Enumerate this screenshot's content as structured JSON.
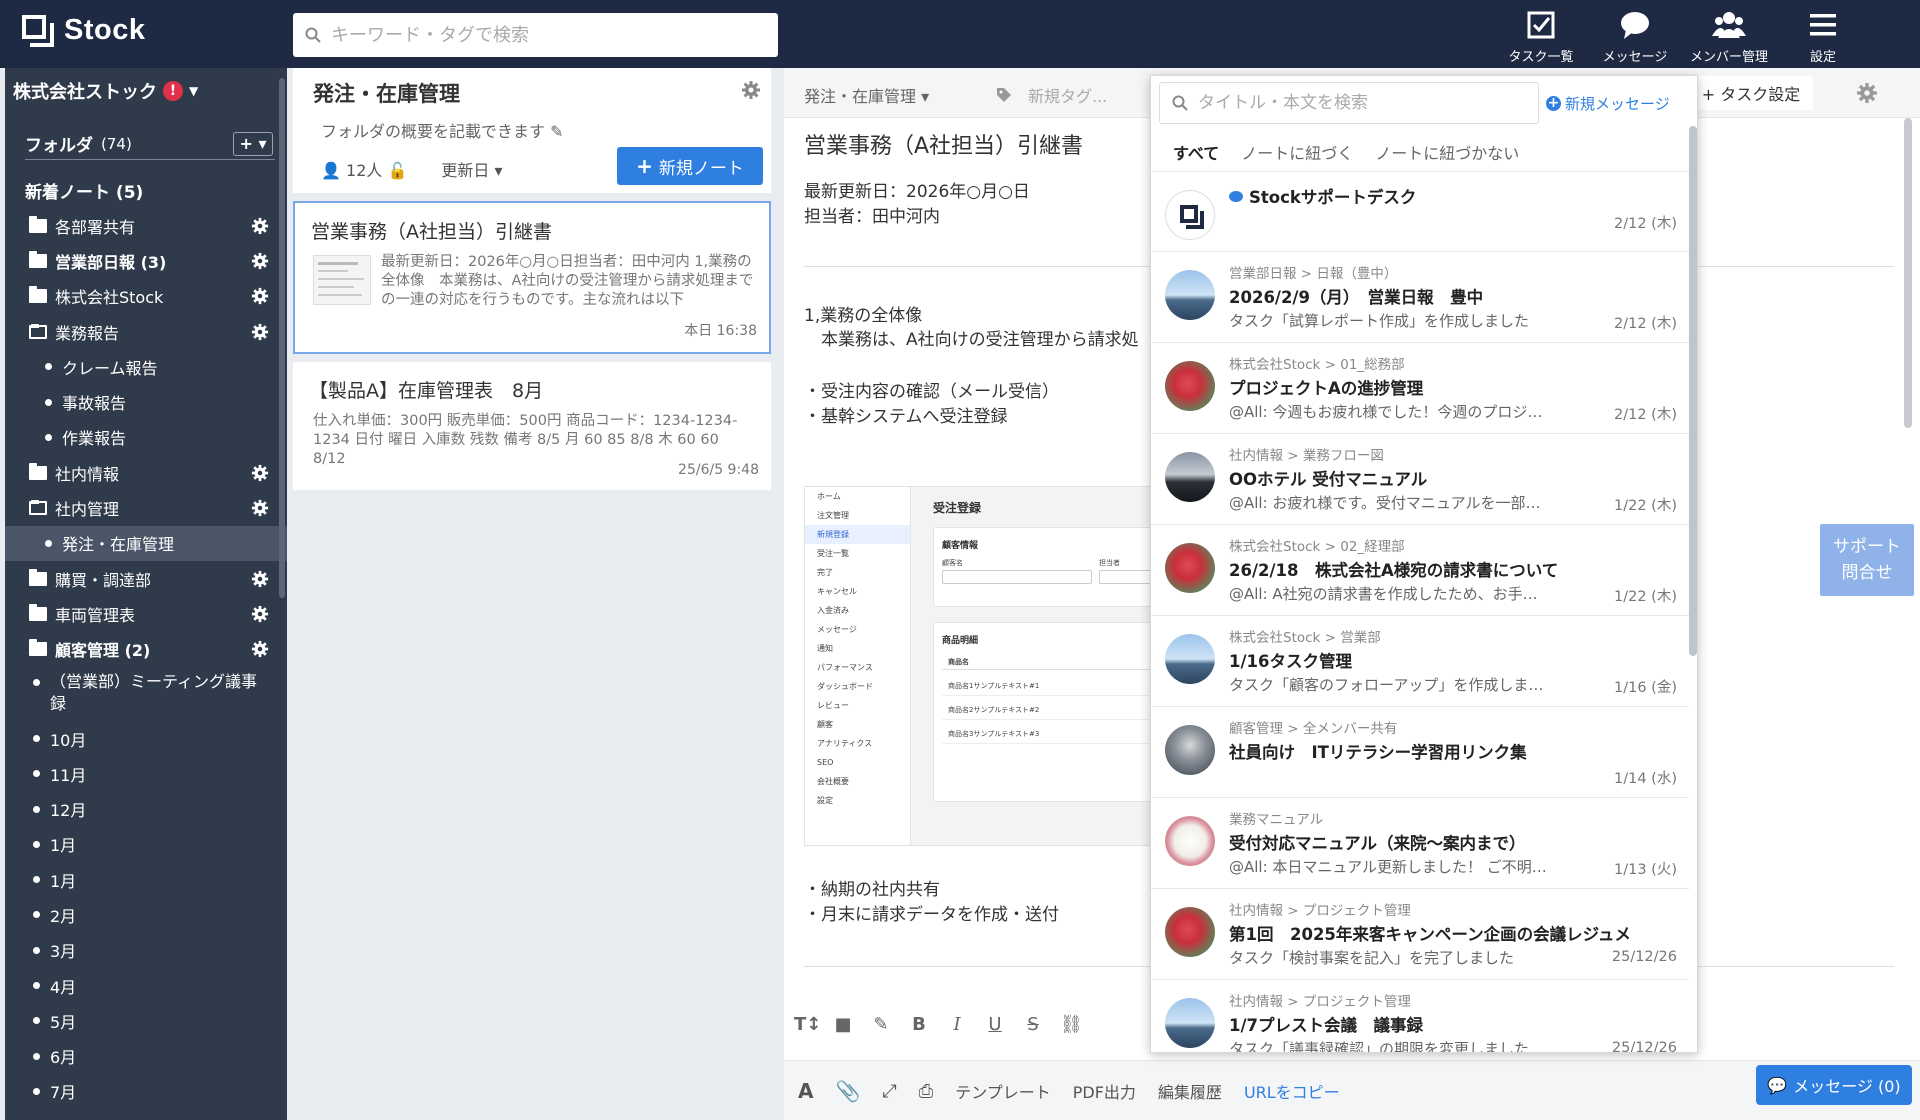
{
  "app": {
    "logo": "Stock",
    "search_placeholder": "キーワード・タグで検索",
    "nav": [
      {
        "label": "タスク一覧",
        "icon": "task-list-icon"
      },
      {
        "label": "メッセージ",
        "icon": "message-icon"
      },
      {
        "label": "メンバー管理",
        "icon": "members-icon"
      },
      {
        "label": "設定",
        "icon": "menu-icon"
      }
    ]
  },
  "sidebar": {
    "company": "株式会社ストック",
    "folder_label": "フォルダ",
    "folder_count": "(74)",
    "add_label": "+ ▾",
    "new_notes": "新着ノート (5)",
    "items": [
      {
        "label": "各部署共有",
        "type": "folder"
      },
      {
        "label": "営業部日報 (3)",
        "type": "folder",
        "bold": true
      },
      {
        "label": "株式会社Stock",
        "type": "folder"
      },
      {
        "label": "業務報告",
        "type": "folder-open"
      },
      {
        "label": "クレーム報告",
        "type": "sub"
      },
      {
        "label": "事故報告",
        "type": "sub"
      },
      {
        "label": "作業報告",
        "type": "sub"
      },
      {
        "label": "社内情報",
        "type": "folder"
      },
      {
        "label": "社内管理",
        "type": "folder-open"
      },
      {
        "label": "発注・在庫管理",
        "type": "sub",
        "selected": true
      },
      {
        "label": "購買・調達部",
        "type": "folder"
      },
      {
        "label": "車両管理表",
        "type": "folder"
      },
      {
        "label": "顧客管理 (2)",
        "type": "folder",
        "bold": true
      },
      {
        "label": "（営業部）ミーティング議事録",
        "type": "root-tall"
      },
      {
        "label": "10月",
        "type": "root"
      },
      {
        "label": "11月",
        "type": "root"
      },
      {
        "label": "12月",
        "type": "root"
      },
      {
        "label": "1月",
        "type": "root"
      },
      {
        "label": "1月",
        "type": "root"
      },
      {
        "label": "2月",
        "type": "root"
      },
      {
        "label": "3月",
        "type": "root"
      },
      {
        "label": "4月",
        "type": "root"
      },
      {
        "label": "5月",
        "type": "root"
      },
      {
        "label": "6月",
        "type": "root"
      },
      {
        "label": "7月",
        "type": "root"
      }
    ]
  },
  "notes": {
    "folder_title": "発注・在庫管理",
    "folder_desc": "フォルダの概要を記載できます",
    "members": "12人",
    "sort": "更新日 ▾",
    "new_note": "新規ノート",
    "cards": [
      {
        "title": "営業事務（A社担当）引継書",
        "body": "最新更新日：2026年○月○日担当者：田中河内 1,業務の全体像　本業務は、A社向けの受注管理から請求処理までの一連の対応を行うものです。主な流れは以下",
        "date": "本日 16:38"
      },
      {
        "title": "【製品A】在庫管理表　8月",
        "body": "仕入れ単価：300円 販売単価：500円 商品コード：1234-1234-1234 日付 曜日 入庫数 残数 備考 8/5 月 60 85 8/8 木 60 60 8/12",
        "date": "25/6/5 9:48"
      }
    ]
  },
  "editor": {
    "breadcrumb": "発注・在庫管理 ▾",
    "tag_new": "新規タグ...",
    "task_settings": "+ タスク設定",
    "title": "営業事務（A社担当）引継書",
    "meta1": "最新更新日：2026年○月○日",
    "meta2": "担当者：田中河内",
    "h1": "1,業務の全体像",
    "p1": "　本業務は、A社向けの受注管理から請求処",
    "b1": "・受注内容の確認（メール受信）",
    "b2": "・基幹システムへ受注登録",
    "b3": "・納期の社内共有",
    "b4": "・月末に請求データを作成・送付",
    "img": {
      "nav": [
        "ホーム",
        "注文管理",
        "新規登録",
        "受注一覧",
        "完了",
        "キャンセル",
        "入金済み",
        "メッセージ",
        "通知",
        "パフォーマンス",
        "ダッシュボード",
        "レビュー",
        "顧客",
        "アナリティクス",
        "SEO",
        "会社概要",
        "設定"
      ],
      "title": "受注登録",
      "section1": "顧客情報",
      "customer_label": "顧客名",
      "person_label": "担当者",
      "section2": "商品明細",
      "col_product": "商品名",
      "rows": [
        "商品名1サンプルテキスト#1",
        "商品名2サンプルテキスト#2",
        "商品名3サンプルテキスト#3"
      ]
    },
    "bottom": [
      "テンプレート",
      "PDF出力",
      "編集履歴"
    ],
    "copy_url": "URLをコピー",
    "message_btn": "メッセージ (0)",
    "support": "サポート\n問合せ"
  },
  "messages": {
    "search_placeholder": "タイトル・本文を検索",
    "new_message": "新規メッセージ",
    "tabs": [
      "すべて",
      "ノートに紐づく",
      "ノートに紐づかない"
    ],
    "first": {
      "title": "Stockサポートデスク",
      "date": "2/12 (木)"
    },
    "items": [
      {
        "path": "営業部日報 > 日報（豊中）",
        "title": "2026/2/9（月）　営業日報　豊中",
        "sub": "タスク「試算レポート作成」を作成しました",
        "date": "2/12 (木)",
        "avatar": "sky"
      },
      {
        "path": "株式会社Stock > 01_総務部",
        "title": "プロジェクトAの進捗管理",
        "sub": "@All: 今週もお疲れ様でした！今週のプロジ…",
        "date": "2/12 (木)",
        "avatar": "flower"
      },
      {
        "path": "社内情報 > 業務フロー図",
        "title": "OOホテル 受付マニュアル",
        "sub": "@All: お疲れ様です。受付マニュアルを一部…",
        "date": "1/22 (木)",
        "avatar": "dark"
      },
      {
        "path": "株式会社Stock > 02_経理部",
        "title": "26/2/18　株式会社A様宛の請求書について",
        "sub": "@All: A社宛の請求書を作成したため、お手…",
        "date": "1/22 (木)",
        "avatar": "flower"
      },
      {
        "path": "株式会社Stock > 営業部",
        "title": "1/16タスク管理",
        "sub": "タスク「顧客のフォローアップ」を作成しま…",
        "date": "1/16 (金)",
        "avatar": "sky"
      },
      {
        "path": "顧客管理 > 全メンバー共有",
        "title": "社員向け　ITリテラシー学習用リンク集",
        "sub": "",
        "date": "1/14 (水)",
        "avatar": "person"
      },
      {
        "path": "業務マニュアル",
        "title": "受付対応マニュアル（来院～案内まで）",
        "sub": "@All: 本日マニュアル更新しました！ ご不明…",
        "date": "1/13 (火)",
        "avatar": "dog"
      },
      {
        "path": "社内情報 > プロジェクト管理",
        "title": "第1回　2025年来客キャンペーン企画の会議レジュメ",
        "sub": "タスク「検討事案を記入」を完了しました",
        "date": "25/12/26",
        "avatar": "flower"
      },
      {
        "path": "社内情報 > プロジェクト管理",
        "title": "1/7プレスト会議　議事録",
        "sub": "タスク「議事録確認」の期限を変更しました",
        "date": "25/12/26",
        "avatar": "sky"
      }
    ]
  }
}
